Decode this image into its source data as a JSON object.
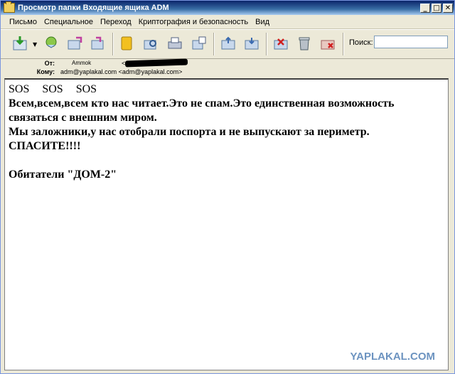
{
  "window": {
    "title": "Просмотр папки Входящие ящика ADM"
  },
  "titlebar_buttons": [
    "_",
    "□",
    "✕"
  ],
  "menu": [
    "Письмо",
    "Специальное",
    "Переход",
    "Криптография и безопасность",
    "Вид"
  ],
  "toolbar": {
    "buttons": [
      "get-mail-icon",
      "reply-icon",
      "reply-all-icon",
      "forward-icon",
      "address-book-icon",
      "find-icon",
      "print-icon",
      "print-preview-icon",
      "previous-icon",
      "next-icon",
      "delete-icon",
      "trash-icon",
      "mark-spam-icon"
    ],
    "search_label": "Поиск:",
    "search_value": ""
  },
  "header": {
    "from_label": "От:",
    "from_name": "Ammok",
    "from_addr_start": "<",
    "to_label": "Кому:",
    "to_value": "adm@yaplakal.com <adm@yaplakal.com>"
  },
  "message": {
    "line1": "SOS  SOS  SOS",
    "line2": "Всем,всем,всем кто нас читает.Это не спам.Это единственная возможность связаться с внешним миром.",
    "line3": "Мы заложники,у нас отобрали поспорта и не выпускают за периметр.",
    "line4": "СПАСИТЕ!!!!",
    "line5": "Обитатели \"ДОМ-2\""
  },
  "watermark": "YAPLAKAL.COM"
}
